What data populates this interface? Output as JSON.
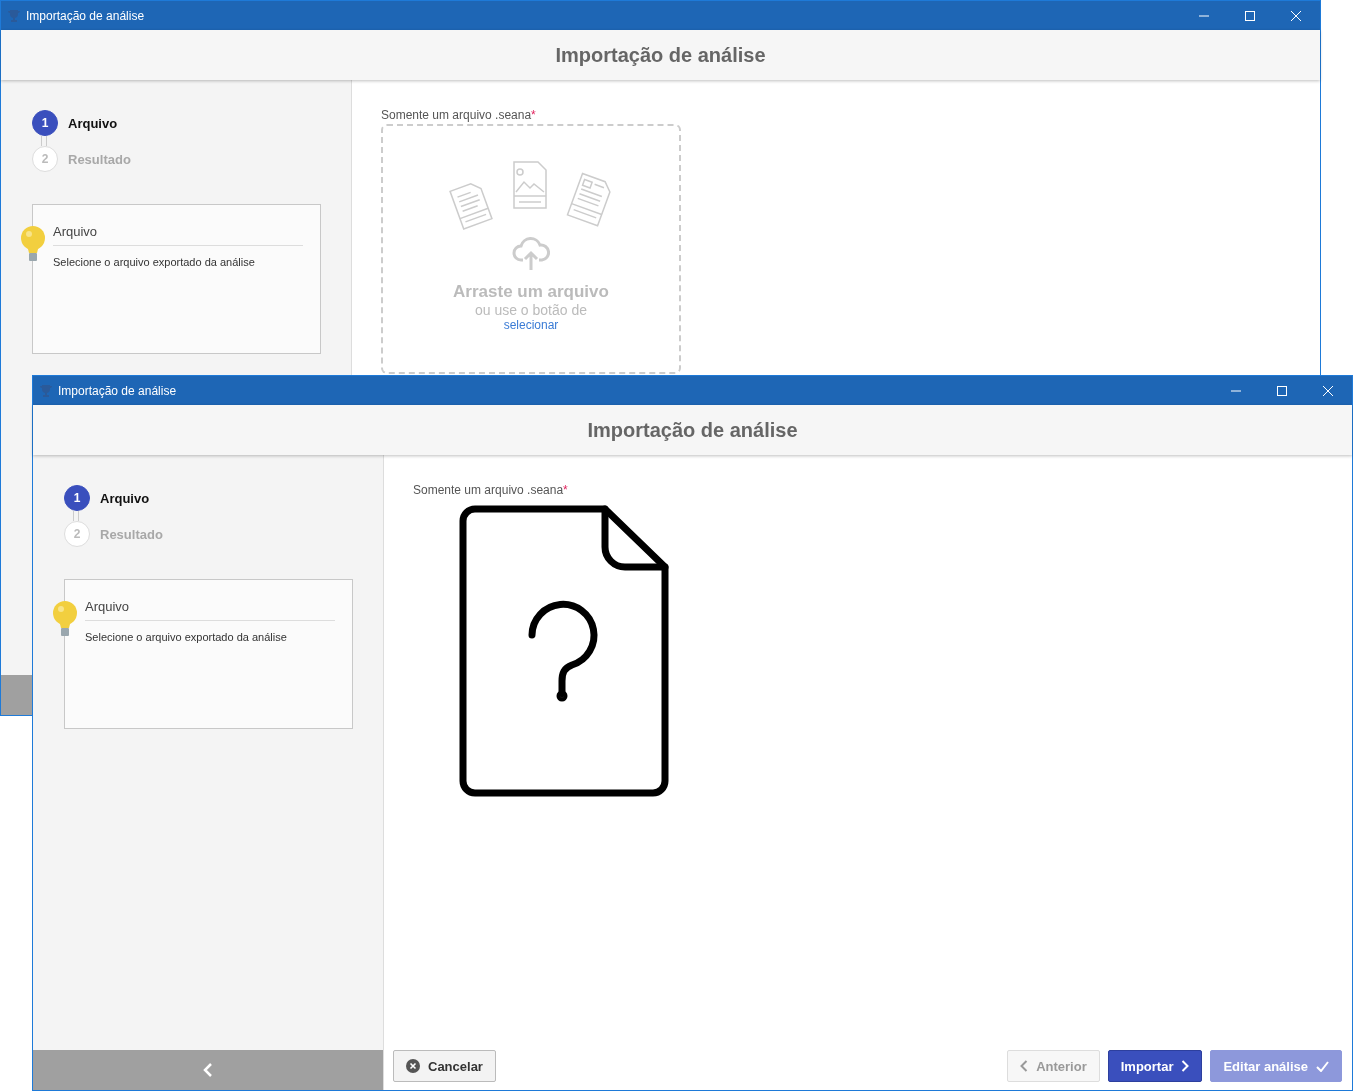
{
  "windows": [
    {
      "title": "Importação de análise",
      "heading": "Importação de análise",
      "steps": [
        {
          "number": "1",
          "label": "Arquivo",
          "selected": true
        },
        {
          "number": "2",
          "label": "Resultado",
          "selected": false
        }
      ],
      "help": {
        "title": "Arquivo",
        "text": "Selecione o arquivo exportado da análise"
      },
      "field_label": "Somente um arquivo .seana",
      "required_mark": "*",
      "content": {
        "kind": "dropzone",
        "title": "Arraste um arquivo",
        "subtitle": "ou use o botão de",
        "link": "selecionar"
      }
    },
    {
      "title": "Importação de análise",
      "heading": "Importação de análise",
      "steps": [
        {
          "number": "1",
          "label": "Arquivo",
          "selected": true
        },
        {
          "number": "2",
          "label": "Resultado",
          "selected": false
        }
      ],
      "help": {
        "title": "Arquivo",
        "text": "Selecione o arquivo exportado da análise"
      },
      "field_label": "Somente um arquivo .seana",
      "required_mark": "*",
      "content": {
        "kind": "unknown-file"
      },
      "buttons": [
        {
          "label": "Cancelar",
          "kind": "cancel",
          "disabled": false
        },
        {
          "label": "Anterior",
          "kind": "previous",
          "disabled": true
        },
        {
          "label": "Importar",
          "kind": "next",
          "disabled": false
        },
        {
          "label": "Editar análise",
          "kind": "finish",
          "disabled": true
        }
      ]
    }
  ]
}
